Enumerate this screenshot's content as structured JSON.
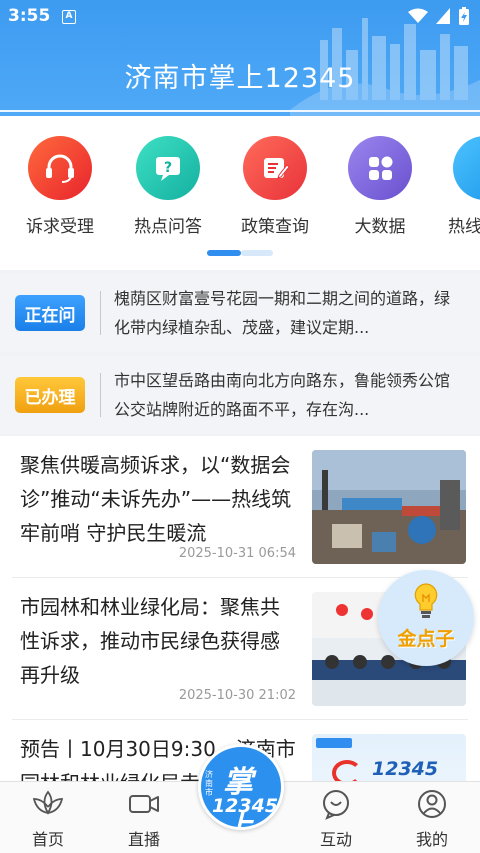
{
  "status_bar": {
    "time": "3:55",
    "notification_letter": "A"
  },
  "header": {
    "title": "济南市掌上12345"
  },
  "quick_menu": [
    {
      "label": "诉求受理",
      "icon": "headset-icon",
      "color": "#f0442e"
    },
    {
      "label": "热点问答",
      "icon": "question-chat-icon",
      "color": "#22c3b0"
    },
    {
      "label": "政策查询",
      "icon": "document-edit-icon",
      "color": "#f0483a"
    },
    {
      "label": "大数据",
      "icon": "grid-data-icon",
      "color": "#7a63d8"
    },
    {
      "label": "热线",
      "icon": "hotline-icon",
      "color": "#27a7f0"
    }
  ],
  "notices": [
    {
      "badge": "正在问",
      "badge_color": "#2a8ef2",
      "text": "槐荫区财富壹号花园一期和二期之间的道路，绿化带内绿植杂乱、茂盛，建议定期..."
    },
    {
      "badge": "已办理",
      "badge_color": "#f2b01c",
      "text": "市中区望岳路由南向北方向路东，鲁能领秀公馆公交站牌附近的路面不平，存在沟..."
    }
  ],
  "news": [
    {
      "title": "聚焦供暖高频诉求，以“数据会诊”推动“未诉先办”——热线筑牢前哨 守护民生暖流",
      "time": "2025-10-31 06:54"
    },
    {
      "title": "市园林和林业绿化局：聚焦共性诉求，推动市民绿色获得感再升级",
      "time": "2025-10-30 21:02"
    },
    {
      "title": "预告丨10月30日9:30，济南市园林和林业绿化局走进",
      "time": "",
      "thumb_text": "12345"
    }
  ],
  "floating_button": {
    "label": "金点子"
  },
  "tabbar": {
    "items": [
      {
        "label": "首页",
        "icon": "lotus-home-icon"
      },
      {
        "label": "直播",
        "icon": "video-camera-icon"
      },
      {
        "label": "互动",
        "icon": "chat-bubble-icon"
      },
      {
        "label": "我的",
        "icon": "user-profile-icon"
      }
    ],
    "center_logo": {
      "main": "掌上",
      "number": "12345",
      "sub": "济南市"
    }
  },
  "colors": {
    "brand_blue": "#3d9bf0",
    "accent_orange": "#f0a000"
  }
}
